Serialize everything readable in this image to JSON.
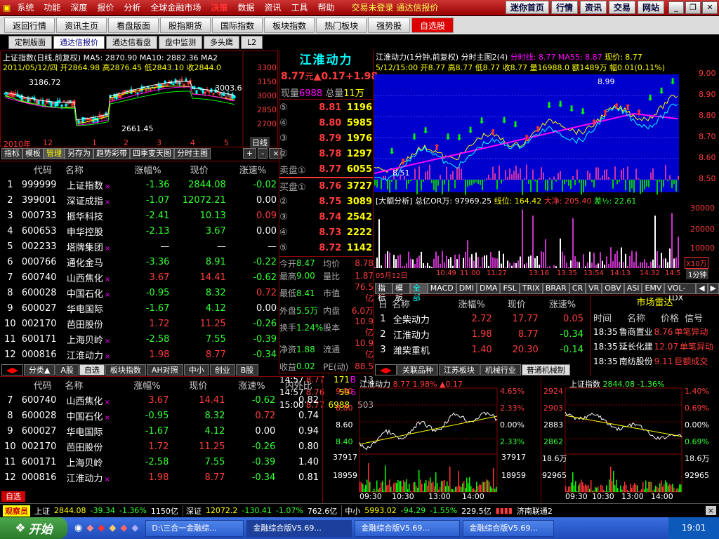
{
  "menu": [
    "系统",
    "功能",
    "深度",
    "报价",
    "分析",
    "全球金融市场",
    "决策",
    "数据",
    "资讯",
    "工具",
    "帮助"
  ],
  "login_notice": "交易未登录  通达信报价",
  "top_buttons": [
    "迷你首页",
    "行情",
    "资讯",
    "交易",
    "网站"
  ],
  "nav_tabs": [
    "返回行情",
    "资讯主页",
    "看盘版面",
    "股指期货",
    "国际指数",
    "板块指数",
    "热门板块",
    "强势股",
    "自选股"
  ],
  "sub_tabs": [
    "定制版面",
    "通达信报价",
    "通达信看盘",
    "盘中监测",
    "多头鹰",
    "L2"
  ],
  "index_chart": {
    "header": "上证指数(日线,前复权) MA5: 2870.90  MA10: 2882.36  MA2",
    "line2": "2011/05/12/四 开2864.98 高2876.45 低2843.10 收2844.0",
    "annot_high": "3186.72",
    "annot_low": "2661.45",
    "annot_right": "3003.6",
    "yticks": [
      "3300",
      "3150",
      "3000",
      "2850",
      "2700"
    ],
    "x_left": "2010年",
    "x_mid": "12",
    "x_marks": [
      "1",
      "2",
      "3",
      "4",
      "5"
    ],
    "corner": "日线",
    "tabs": [
      "指标",
      "模板",
      "管理",
      "另存为",
      "趋势彩带",
      "四季变天图",
      "分时主图"
    ]
  },
  "watch_headers": [
    "代码",
    "名称",
    "涨幅%",
    "现价",
    "涨速%"
  ],
  "watch_rows": [
    {
      "n": "1",
      "code": "999999",
      "name": "上证指数",
      "mark": "×",
      "chg": "-1.36",
      "price": "2844.08",
      "spd": "-0.02",
      "cc": "g",
      "pc": "g",
      "sc": "g"
    },
    {
      "n": "2",
      "code": "399001",
      "name": "深证成指",
      "mark": "×",
      "chg": "-1.07",
      "price": "12072.21",
      "spd": "0.00",
      "cc": "g",
      "pc": "g",
      "sc": "w"
    },
    {
      "n": "3",
      "code": "000733",
      "name": "振华科技",
      "mark": "",
      "chg": "-2.41",
      "price": "10.13",
      "spd": "0.09",
      "cc": "g",
      "pc": "g",
      "sc": "r"
    },
    {
      "n": "4",
      "code": "600653",
      "name": "申华控股",
      "mark": "",
      "chg": "-2.13",
      "price": "3.67",
      "spd": "0.00",
      "cc": "g",
      "pc": "g",
      "sc": "w"
    },
    {
      "n": "5",
      "code": "002233",
      "name": "塔牌集团",
      "mark": "×",
      "chg": "—",
      "price": "—",
      "spd": "—",
      "cc": "w",
      "pc": "w",
      "sc": "w"
    },
    {
      "n": "6",
      "code": "000766",
      "name": "通化金马",
      "mark": "",
      "chg": "-3.36",
      "price": "8.91",
      "spd": "-0.22",
      "cc": "g",
      "pc": "g",
      "sc": "g"
    },
    {
      "n": "7",
      "code": "600740",
      "name": "山西焦化",
      "mark": "×",
      "chg": "3.67",
      "price": "14.41",
      "spd": "-0.62",
      "cc": "r",
      "pc": "r",
      "sc": "g"
    },
    {
      "n": "8",
      "code": "600028",
      "name": "中国石化",
      "mark": "×",
      "chg": "-0.95",
      "price": "8.32",
      "spd": "0.72",
      "cc": "g",
      "pc": "g",
      "sc": "r"
    },
    {
      "n": "9",
      "code": "600027",
      "name": "华电国际",
      "mark": "",
      "chg": "-1.67",
      "price": "4.12",
      "spd": "0.00",
      "cc": "g",
      "pc": "g",
      "sc": "w"
    },
    {
      "n": "10",
      "code": "002170",
      "name": "芭田股份",
      "mark": "",
      "chg": "1.72",
      "price": "11.25",
      "spd": "-0.26",
      "cc": "r",
      "pc": "r",
      "sc": "g"
    },
    {
      "n": "11",
      "code": "600171",
      "name": "上海贝岭",
      "mark": "×",
      "chg": "-2.58",
      "price": "7.55",
      "spd": "-0.39",
      "cc": "g",
      "pc": "g",
      "sc": "g"
    },
    {
      "n": "12",
      "code": "000816",
      "name": "江淮动力",
      "mark": "×",
      "chg": "1.98",
      "price": "8.77",
      "spd": "-0.34",
      "cc": "r",
      "pc": "r",
      "sc": "g"
    }
  ],
  "watch_tabs": [
    "分类▲",
    "A股",
    "自选",
    "板块指数",
    "AH对照",
    "中小",
    "创业",
    "B股"
  ],
  "bottom_headers": [
    "代码",
    "名称",
    "涨幅%",
    "现价",
    "涨速%",
    "内外比"
  ],
  "bottom_rows": [
    {
      "n": "7",
      "code": "600740",
      "name": "山西焦化",
      "mark": "×",
      "chg": "3.67",
      "price": "14.41",
      "spd": "-0.62",
      "ratio": "0.82",
      "cc": "r",
      "pc": "r",
      "sc": "g"
    },
    {
      "n": "8",
      "code": "600028",
      "name": "中国石化",
      "mark": "×",
      "chg": "-0.95",
      "price": "8.32",
      "spd": "0.72",
      "ratio": "0.74",
      "cc": "g",
      "pc": "g",
      "sc": "r"
    },
    {
      "n": "9",
      "code": "600027",
      "name": "华电国际",
      "mark": "",
      "chg": "-1.67",
      "price": "4.12",
      "spd": "0.00",
      "ratio": "0.94",
      "cc": "g",
      "pc": "g",
      "sc": "w"
    },
    {
      "n": "10",
      "code": "002170",
      "name": "芭田股份",
      "mark": "",
      "chg": "1.72",
      "price": "11.25",
      "spd": "-0.26",
      "ratio": "0.80",
      "cc": "r",
      "pc": "r",
      "sc": "g"
    },
    {
      "n": "11",
      "code": "600171",
      "name": "上海贝岭",
      "mark": "",
      "chg": "-2.58",
      "price": "7.55",
      "spd": "-0.39",
      "ratio": "1.40",
      "cc": "g",
      "pc": "g",
      "sc": "g"
    },
    {
      "n": "12",
      "code": "000816",
      "name": "江淮动力",
      "mark": "×",
      "chg": "1.98",
      "price": "8.77",
      "spd": "-0.34",
      "ratio": "0.81",
      "cc": "r",
      "pc": "r",
      "sc": "g"
    }
  ],
  "bottom_tab": "自选",
  "stock": {
    "name": "江淮动力",
    "price": "8.77",
    "yuan": "元",
    "chg": "▲0.17",
    "pct": "+1.98",
    "xianliang_label": "现量",
    "xianliang": "6988",
    "zongliang_label": "总量",
    "zongliang": "11万",
    "sells": [
      {
        "l": "⑤",
        "p": "8.81",
        "v": "1196"
      },
      {
        "l": "④",
        "p": "8.80",
        "v": "5985"
      },
      {
        "l": "③",
        "p": "8.79",
        "v": "1976"
      },
      {
        "l": "②",
        "p": "8.78",
        "v": "1297"
      },
      {
        "l": "卖盘①",
        "p": "8.77",
        "v": "6055"
      }
    ],
    "buys": [
      {
        "l": "买盘①",
        "p": "8.76",
        "v": "3727"
      },
      {
        "l": "②",
        "p": "8.75",
        "v": "3089"
      },
      {
        "l": "③",
        "p": "8.74",
        "v": "2542"
      },
      {
        "l": "④",
        "p": "8.73",
        "v": "2222"
      },
      {
        "l": "⑤",
        "p": "8.72",
        "v": "1142"
      }
    ],
    "stats": [
      [
        "今开",
        "8.47",
        "均价",
        "8.78"
      ],
      [
        "最高",
        "9.00",
        "量比",
        "1.87"
      ],
      [
        "最低",
        "8.41",
        "市值",
        "76.5亿"
      ],
      [
        "外盘",
        "5.5万",
        "内盘",
        "6.0万"
      ],
      [
        "换手",
        "1.24%",
        "股本",
        "10.9亿"
      ],
      [
        "净资",
        "1.88",
        "流通",
        "10.9亿"
      ],
      [
        "收益",
        "0.02",
        "PE(动)",
        "88.5"
      ]
    ],
    "ticks": [
      [
        "14:57",
        "8.77",
        "171",
        "B",
        "13"
      ],
      [
        "14:57",
        "8.76",
        "59",
        "6",
        ""
      ],
      [
        "15:00",
        "8.77",
        "6988",
        "",
        "503"
      ]
    ]
  },
  "intraday": {
    "header": "江淮动力(1分钟,前复权) 分时主图2(4)",
    "h_fen": "分时线: 8.77",
    "h_ma": "MA55: 8.87",
    "h_now": "现价: 8.77",
    "line2": "5/12/15:00 开8.77 高8.77 低8.77 收8.77 量16988.0 额1489万 幅0.01(0.11%)",
    "yticks": [
      "9.00",
      "8.90",
      "8.80",
      "8.70",
      "8.60",
      "8.50"
    ],
    "annot": "8.99",
    "annot_low": "8.51",
    "vol_header": "[大额分析]",
    "vol_total": "总亿OR万: 97969.25",
    "vol_line": "线位: 164.42",
    "vol_big": "大净: 205.40",
    "vol_diff": "差½: 22.61",
    "vol_yticks": [
      "30000",
      "20000",
      "10000"
    ],
    "vol_unit": "X10万",
    "xlabels": [
      "05月12日",
      "10:49",
      "11:00",
      "11:27",
      "13:16",
      "13:35",
      "13:54",
      "14:13",
      "14:32",
      "14:5"
    ],
    "right_label": "1分钟",
    "tabs": [
      "指标",
      "模板",
      "全部",
      "MACD",
      "DMI",
      "DMA",
      "FSL",
      "TRIX",
      "BRAR",
      "CR",
      "VR",
      "OBV",
      "ASI",
      "EMV",
      "VOL-TDX"
    ]
  },
  "related": {
    "headers": [
      "日",
      "名称",
      "涨幅%",
      "现价",
      "涨速%"
    ],
    "rows": [
      {
        "n": "1",
        "name": "全柴动力",
        "chg": "2.72",
        "price": "17.77",
        "spd": "0.05",
        "sc": "r"
      },
      {
        "n": "2",
        "name": "江淮动力",
        "chg": "1.98",
        "price": "8.77",
        "spd": "-0.34",
        "sc": "g"
      },
      {
        "n": "3",
        "name": "潍柴重机",
        "chg": "1.40",
        "price": "20.30",
        "spd": "-0.14",
        "sc": "g"
      }
    ],
    "tabs": [
      "关联品种",
      "江苏板块",
      "机械行业",
      "普通机械制"
    ]
  },
  "radar": {
    "title": "市场雷达",
    "headers": [
      "时间",
      "名称",
      "价格",
      "信号"
    ],
    "rows": [
      {
        "time": "18:35",
        "name": "鲁商置业",
        "price": "8.76",
        "sig": "单笔异动"
      },
      {
        "time": "18:35",
        "name": "延长化建",
        "price": "12.07",
        "sig": "单笔异动"
      },
      {
        "time": "18:35",
        "name": "南纺股份",
        "price": "9.11",
        "sig": "巨额成交"
      }
    ]
  },
  "mini1": {
    "title": "江淮动力",
    "price": "8.77",
    "pct": "1.98%",
    "chg": "▲0.17",
    "yl": [
      "9.00",
      "8.80",
      "8.60",
      "8.40"
    ],
    "yr": [
      "4.65%",
      "2.33%",
      "0.00%",
      "2.33%"
    ],
    "vol": [
      "37917",
      "18959"
    ],
    "x": [
      "09:30",
      "10:30",
      "13:00",
      "14:00"
    ]
  },
  "mini2": {
    "title": "上证指数",
    "price": "2844.08",
    "pct": "-1.36%",
    "yl": [
      "2924",
      "2903",
      "2883",
      "2862"
    ],
    "yr": [
      "1.40%",
      "0.69%",
      "0.00%",
      "0.69%"
    ],
    "vol": [
      "18.6万",
      "92965"
    ],
    "vol_r": [
      "18.6万",
      "92965"
    ],
    "x": [
      "09:30",
      "10:30",
      "13:00",
      "14:00"
    ]
  },
  "status": {
    "watcher": "观察员",
    "sh_label": "上证",
    "sh": "2844.08",
    "sh_chg": "-39.34",
    "sh_pct": "-1.36%",
    "sh_amt": "1150亿",
    "sz_label": "深证",
    "sz": "12072.2",
    "sz_chg": "-130.41",
    "sz_pct": "-1.07%",
    "sz_amt": "762.6亿",
    "zx_label": "中小",
    "zx": "5993.02",
    "zx_chg": "-94.29",
    "zx_pct": "-1.55%",
    "zx_amt": "229.5亿",
    "net": "济南联通2"
  },
  "taskbar": {
    "start": "开始",
    "items": [
      "D:\\三合一金融综...",
      "金融综合版V5.69...",
      "金融综合版V5.69...",
      "金融综合版V5.69..."
    ],
    "clock": "19:01"
  },
  "colors": {
    "up": "#ff3c3c",
    "down": "#33ff33",
    "accent": "#ffff00",
    "cyan": "#00ffff"
  }
}
